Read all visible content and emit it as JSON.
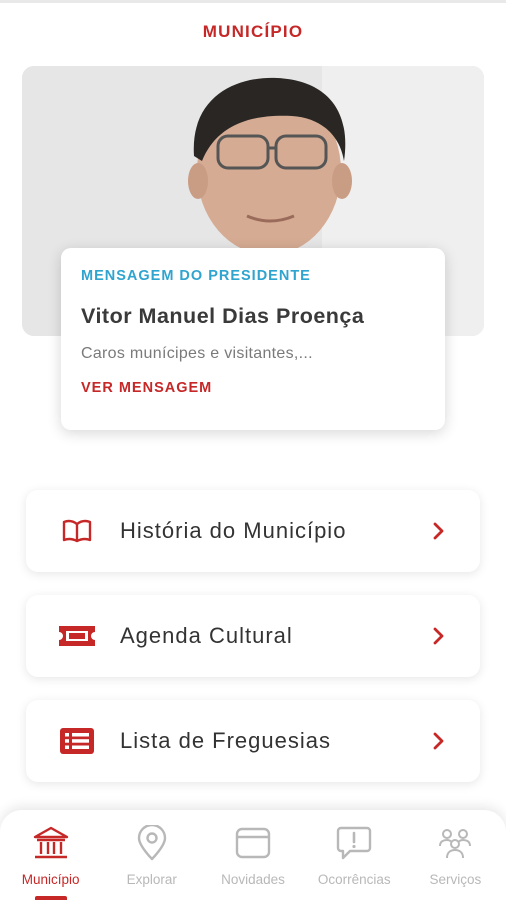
{
  "header": {
    "title": "MUNICÍPIO"
  },
  "president_message": {
    "kicker": "MENSAGEM DO PRESIDENTE",
    "name": "Vitor Manuel Dias Proença",
    "excerpt": "Caros munícipes e visitantes,...",
    "link_label": "VER MENSAGEM"
  },
  "menu": [
    {
      "label": "História do Município",
      "icon": "book-icon"
    },
    {
      "label": "Agenda Cultural",
      "icon": "ticket-icon"
    },
    {
      "label": "Lista de Freguesias",
      "icon": "list-icon"
    }
  ],
  "bottom_nav": [
    {
      "label": "Município",
      "icon": "building-icon",
      "active": true
    },
    {
      "label": "Explorar",
      "icon": "map-pin-icon",
      "active": false
    },
    {
      "label": "Novidades",
      "icon": "news-icon",
      "active": false
    },
    {
      "label": "Ocorrências",
      "icon": "alert-chat-icon",
      "active": false
    },
    {
      "label": "Serviços",
      "icon": "services-icon",
      "active": false
    }
  ],
  "colors": {
    "accent": "#c62828",
    "kicker": "#2fa4cf",
    "inactive": "#b8b8b8"
  }
}
